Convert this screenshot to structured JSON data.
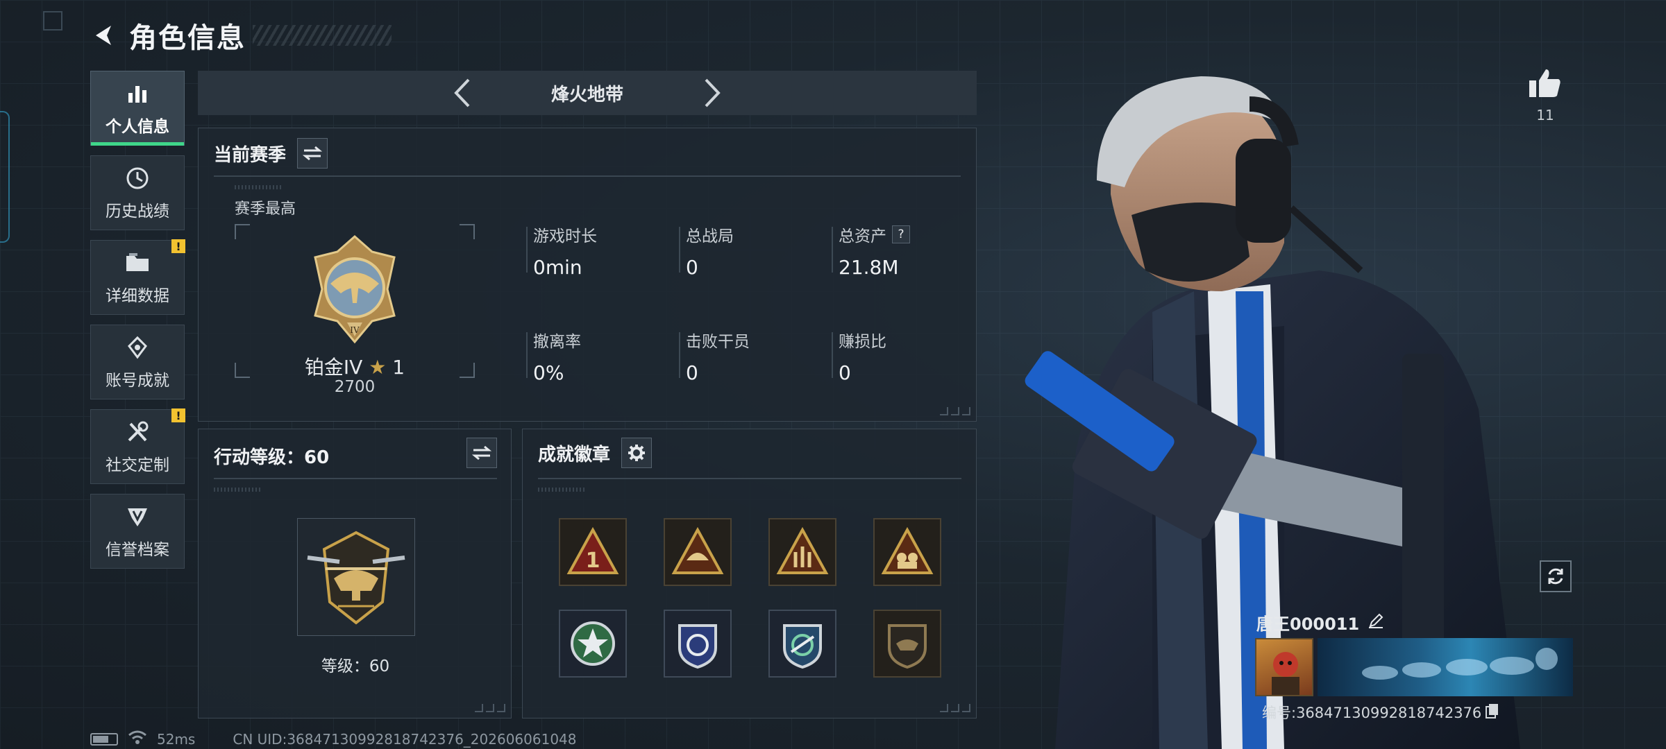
{
  "header": {
    "title": "角色信息"
  },
  "sidebar": {
    "items": [
      {
        "label": "个人信息",
        "icon": "bar-chart-icon",
        "active": true
      },
      {
        "label": "历史战绩",
        "icon": "history-icon"
      },
      {
        "label": "详细数据",
        "icon": "folder-icon",
        "badge": "!"
      },
      {
        "label": "账号成就",
        "icon": "achievement-icon"
      },
      {
        "label": "社交定制",
        "icon": "tools-icon",
        "badge": "!"
      },
      {
        "label": "信誉档案",
        "icon": "credit-icon"
      }
    ]
  },
  "mode": {
    "name": "烽火地带"
  },
  "season": {
    "title": "当前赛季",
    "subtitle": "赛季最高",
    "rank_name": "铂金IV",
    "rank_stars": "1",
    "rank_score": "2700",
    "stats": [
      {
        "label": "游戏时长",
        "value": "0min"
      },
      {
        "label": "总战局",
        "value": "0"
      },
      {
        "label": "总资产",
        "value": "21.8M",
        "help": "?"
      },
      {
        "label": "撤离率",
        "value": "0%"
      },
      {
        "label": "击败干员",
        "value": "0"
      },
      {
        "label": "赚损比",
        "value": "0"
      }
    ]
  },
  "level": {
    "title": "行动等级：60",
    "level_text": "等级：60"
  },
  "badges": {
    "title": "成就徽章",
    "items": [
      "badge-icon-1",
      "badge-icon-2",
      "badge-icon-3",
      "badge-icon-4",
      "badge-icon-5",
      "badge-icon-6",
      "badge-icon-7",
      "badge-icon-8"
    ]
  },
  "player": {
    "likes": "11",
    "name": "唐王000011",
    "id": "编号:3684713099281874237​6"
  },
  "status": {
    "ping": "52ms",
    "uid": "CN UID:36847130992818742376_202606061048"
  },
  "colors": {
    "accent": "#3fd68a",
    "warning": "#f2c230",
    "gold": "#c9a24a"
  }
}
